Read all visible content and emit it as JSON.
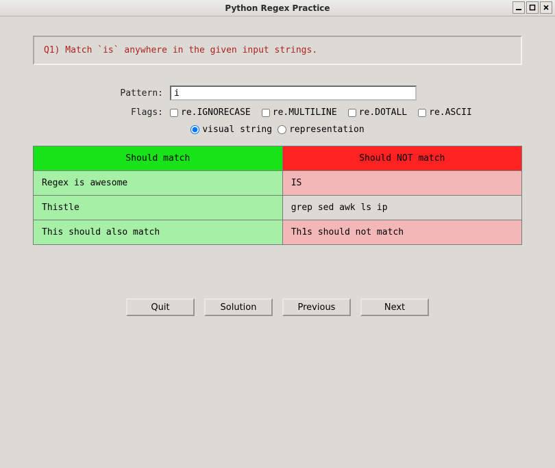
{
  "window": {
    "title": "Python Regex Practice"
  },
  "question": {
    "text": "Q1) Match `is` anywhere in the given input strings."
  },
  "form": {
    "pattern_label": "Pattern:",
    "pattern_value": "i",
    "flags_label": "Flags:",
    "flags": {
      "ignorecase": "re.IGNORECASE",
      "multiline": "re.MULTILINE",
      "dotall": "re.DOTALL",
      "ascii": "re.ASCII"
    },
    "view": {
      "visual": "visual string",
      "repr": "representation"
    }
  },
  "table": {
    "headers": {
      "match": "Should match",
      "nomatch": "Should NOT match"
    },
    "rows": [
      {
        "match": "Regex is awesome",
        "nomatch": "IS",
        "match_cls": "green",
        "nomatch_cls": "pink"
      },
      {
        "match": "Thistle",
        "nomatch": "grep sed awk ls ip",
        "match_cls": "green",
        "nomatch_cls": "gray"
      },
      {
        "match": "This should also match",
        "nomatch": "Th1s should not match",
        "match_cls": "green",
        "nomatch_cls": "pink"
      }
    ]
  },
  "buttons": {
    "quit": "Quit",
    "solution": "Solution",
    "previous": "Previous",
    "next": "Next"
  }
}
